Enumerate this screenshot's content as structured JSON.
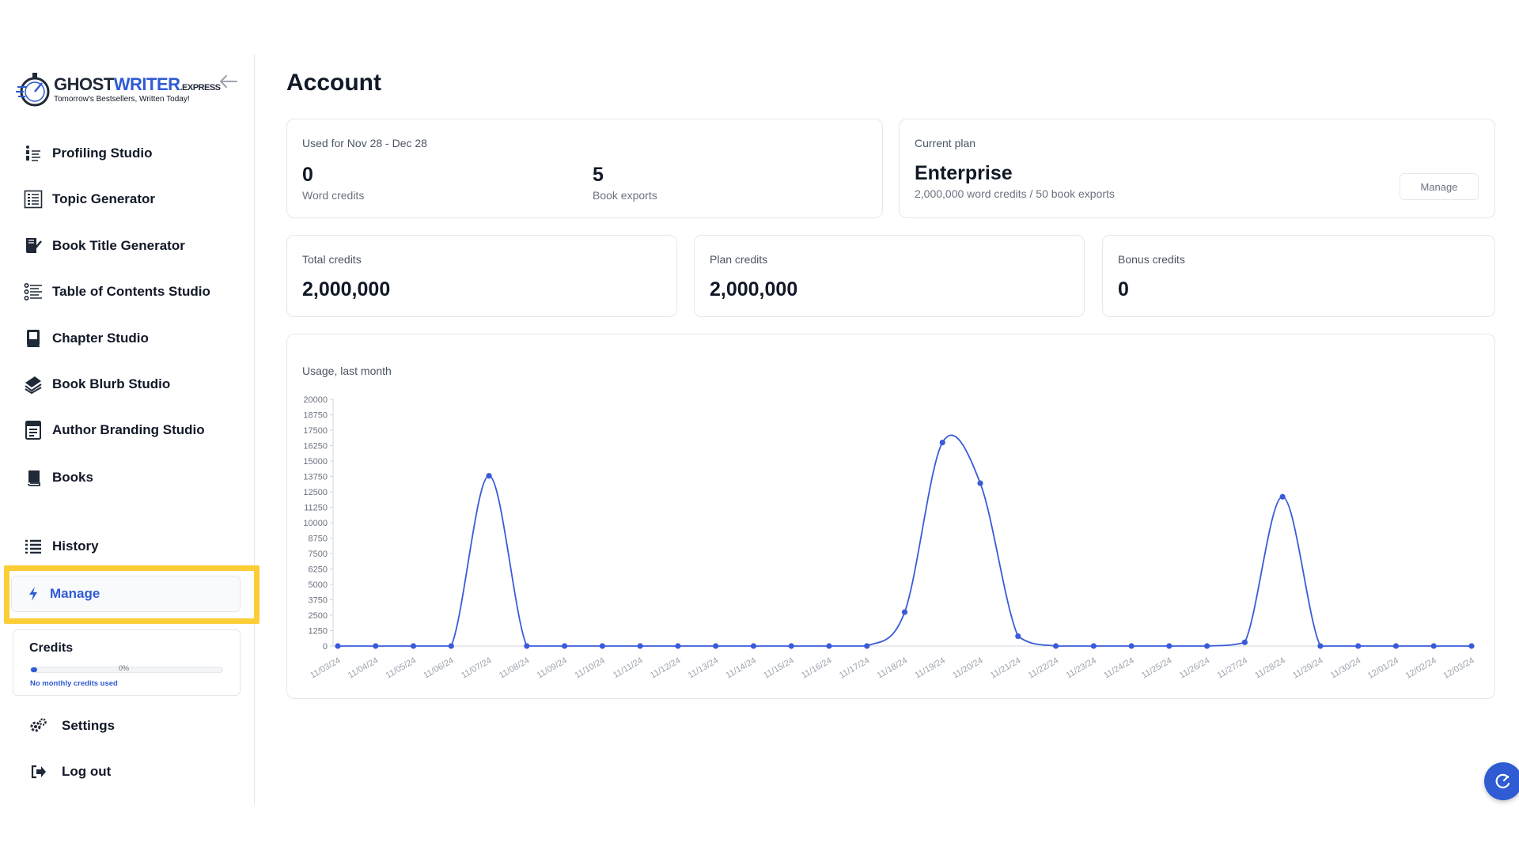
{
  "brand": {
    "name_a": "GHOST",
    "name_b": "WRITER",
    "name_c": ".EXPRESS",
    "tagline": "Tomorrow's Bestsellers, Written Today!"
  },
  "sidebar": {
    "items": [
      {
        "label": "Profiling Studio",
        "icon": "profile-list-icon"
      },
      {
        "label": "Topic Generator",
        "icon": "checklist-icon"
      },
      {
        "label": "Book Title Generator",
        "icon": "book-pen-icon"
      },
      {
        "label": "Table of Contents Studio",
        "icon": "toc-list-icon"
      },
      {
        "label": "Chapter Studio",
        "icon": "chapter-book-icon"
      },
      {
        "label": "Book Blurb Studio",
        "icon": "blurb-books-icon"
      },
      {
        "label": "Author Branding Studio",
        "icon": "branding-icon"
      },
      {
        "label": "Books",
        "icon": "book-icon"
      }
    ],
    "history": "History",
    "manage": "Manage",
    "settings": "Settings",
    "logout": "Log out",
    "credits": {
      "title": "Credits",
      "percent": "0%",
      "fraction_used": 0.02,
      "note": "No monthly credits used"
    }
  },
  "account": {
    "title": "Account",
    "usage_period": "Used for Nov 28 - Dec 28",
    "word_credits_value": "0",
    "word_credits_label": "Word credits",
    "book_exports_value": "5",
    "book_exports_label": "Book exports",
    "plan_label": "Current plan",
    "plan_name": "Enterprise",
    "plan_details": "2,000,000 word credits / 50 book exports",
    "manage_button": "Manage",
    "total_credits_label": "Total credits",
    "total_credits_value": "2,000,000",
    "plan_credits_label": "Plan credits",
    "plan_credits_value": "2,000,000",
    "bonus_credits_label": "Bonus credits",
    "bonus_credits_value": "0"
  },
  "colors": {
    "accent": "#2f5bd3",
    "highlight": "#fbcd36",
    "line": "#3a5bd9"
  },
  "chart_data": {
    "type": "line",
    "title": "Usage, last month",
    "x": [
      "11/03/24",
      "11/04/24",
      "11/05/24",
      "11/06/24",
      "11/07/24",
      "11/08/24",
      "11/09/24",
      "11/10/24",
      "11/11/24",
      "11/12/24",
      "11/13/24",
      "11/14/24",
      "11/15/24",
      "11/16/24",
      "11/17/24",
      "11/18/24",
      "11/19/24",
      "11/20/24",
      "11/21/24",
      "11/22/24",
      "11/23/24",
      "11/24/24",
      "11/25/24",
      "11/26/24",
      "11/27/24",
      "11/28/24",
      "11/29/24",
      "11/30/24",
      "12/01/24",
      "12/02/24",
      "12/03/24"
    ],
    "series": [
      {
        "values": [
          0,
          0,
          0,
          0,
          13800,
          0,
          0,
          0,
          0,
          0,
          0,
          0,
          0,
          0,
          0,
          2750,
          16500,
          13200,
          800,
          0,
          0,
          0,
          0,
          0,
          300,
          12100,
          0,
          0,
          0,
          0,
          0
        ]
      }
    ],
    "yticks": [
      0,
      1250,
      2500,
      3750,
      5000,
      6250,
      7500,
      8750,
      10000,
      11250,
      12500,
      13750,
      15000,
      16250,
      17500,
      18750,
      20000
    ],
    "ylim": [
      0,
      20000
    ],
    "grid": false,
    "legend": "none"
  }
}
